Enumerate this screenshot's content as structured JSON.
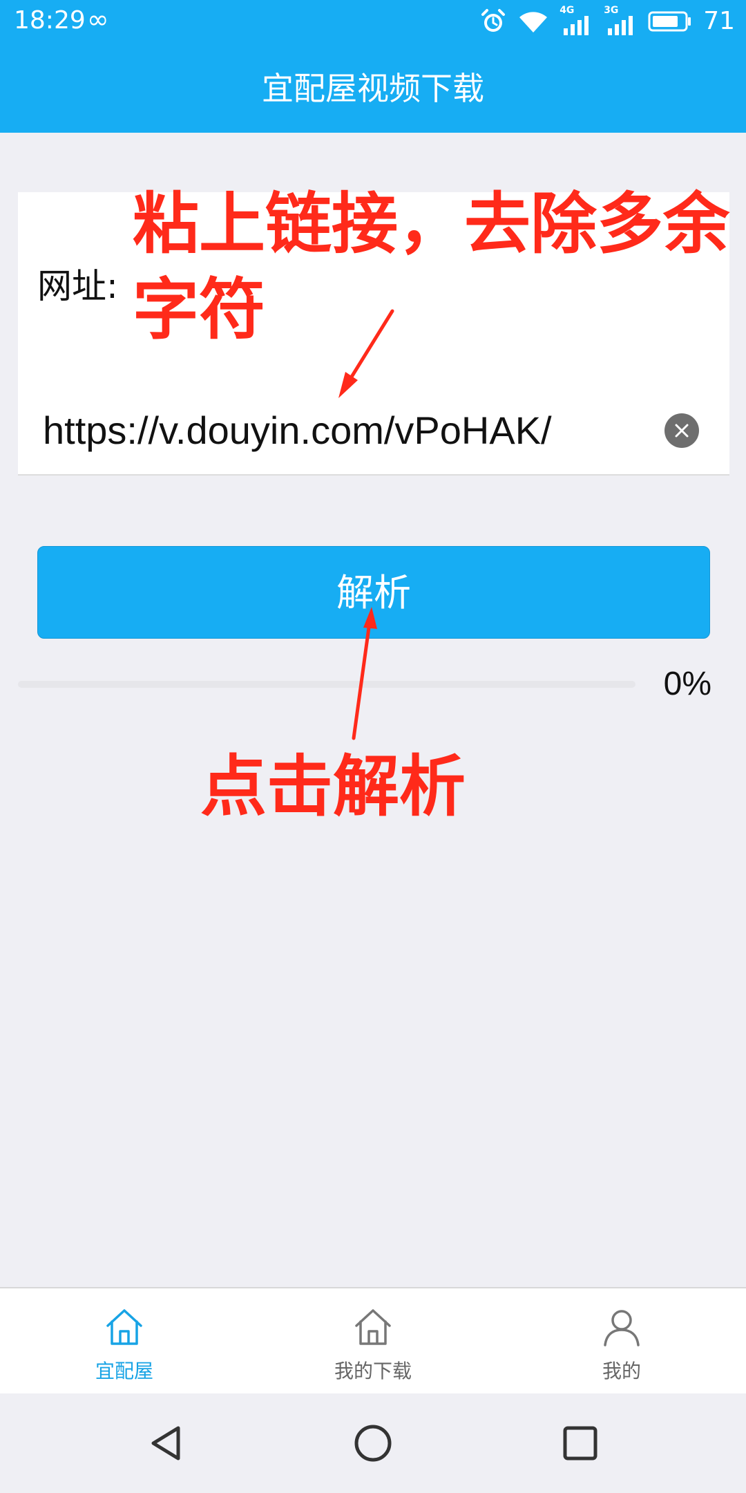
{
  "status_bar": {
    "time": "18:29",
    "infinity": "∞",
    "network_1": "4G",
    "network_2": "3G",
    "battery": "71",
    "icons": [
      "alarm-icon",
      "wifi-icon",
      "signal-icon",
      "battery-icon"
    ]
  },
  "header": {
    "title": "宜配屋视频下载"
  },
  "form": {
    "url_label": "网址:",
    "url_value": "https://v.douyin.com/vPoHAK/",
    "clear_icon": "close-icon"
  },
  "parse_button": {
    "label": "解析"
  },
  "progress": {
    "value": 0,
    "text": "0%"
  },
  "annotations": {
    "top": "粘上链接，去除多余字符",
    "bottom": "点击解析",
    "color": "#ff2a1a"
  },
  "tabbar": {
    "tabs": [
      {
        "label": "宜配屋",
        "icon": "home-icon",
        "active": true
      },
      {
        "label": "我的下载",
        "icon": "home-icon",
        "active": false
      },
      {
        "label": "我的",
        "icon": "user-icon",
        "active": false
      }
    ]
  },
  "navbar": {
    "icons": [
      "back-icon",
      "home-circle-icon",
      "recents-icon"
    ]
  },
  "colors": {
    "accent": "#17adf3",
    "background": "#efeff4",
    "tab_active": "#17a3e5",
    "tab_inactive": "#666666"
  }
}
